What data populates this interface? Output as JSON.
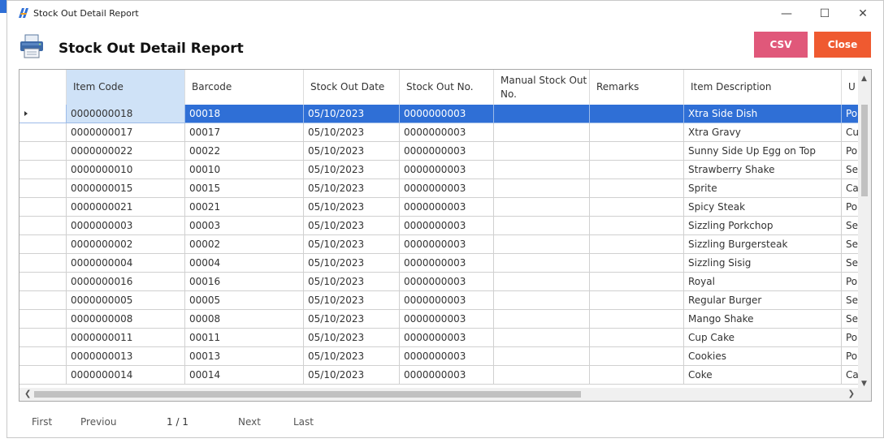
{
  "window": {
    "title": "Stock Out Detail Report",
    "min_glyph": "—",
    "max_glyph": "☐",
    "close_glyph": "✕"
  },
  "header": {
    "title": "Stock Out Detail Report",
    "csv_label": "CSV",
    "close_label": "Close"
  },
  "colors": {
    "accent": "#2f6fd6",
    "csv": "#e0587a",
    "close": "#ef5a30",
    "selected_header": "#cfe2f7"
  },
  "table": {
    "columns": [
      "Item Code",
      "Barcode",
      "Stock Out Date",
      "Stock Out No.",
      "Manual Stock Out No.",
      "Remarks",
      "Item Description",
      "U"
    ],
    "selected_row": 0,
    "rows": [
      [
        "0000000018",
        "00018",
        "05/10/2023",
        "0000000003",
        "",
        "",
        "Xtra Side Dish",
        "Po"
      ],
      [
        "0000000017",
        "00017",
        "05/10/2023",
        "0000000003",
        "",
        "",
        "Xtra Gravy",
        "Cu"
      ],
      [
        "0000000022",
        "00022",
        "05/10/2023",
        "0000000003",
        "",
        "",
        "Sunny Side Up Egg on Top",
        "Po"
      ],
      [
        "0000000010",
        "00010",
        "05/10/2023",
        "0000000003",
        "",
        "",
        "Strawberry Shake",
        "Se"
      ],
      [
        "0000000015",
        "00015",
        "05/10/2023",
        "0000000003",
        "",
        "",
        "Sprite",
        "Ca"
      ],
      [
        "0000000021",
        "00021",
        "05/10/2023",
        "0000000003",
        "",
        "",
        "Spicy Steak",
        "Po"
      ],
      [
        "0000000003",
        "00003",
        "05/10/2023",
        "0000000003",
        "",
        "",
        "Sizzling Porkchop",
        "Se"
      ],
      [
        "0000000002",
        "00002",
        "05/10/2023",
        "0000000003",
        "",
        "",
        "Sizzling Burgersteak",
        "Se"
      ],
      [
        "0000000004",
        "00004",
        "05/10/2023",
        "0000000003",
        "",
        "",
        "Sizzling  Sisig",
        "Se"
      ],
      [
        "0000000016",
        "00016",
        "05/10/2023",
        "0000000003",
        "",
        "",
        "Royal",
        "Po"
      ],
      [
        "0000000005",
        "00005",
        "05/10/2023",
        "0000000003",
        "",
        "",
        "Regular Burger",
        "Se"
      ],
      [
        "0000000008",
        "00008",
        "05/10/2023",
        "0000000003",
        "",
        "",
        "Mango Shake",
        "Se"
      ],
      [
        "0000000011",
        "00011",
        "05/10/2023",
        "0000000003",
        "",
        "",
        "Cup Cake",
        "Po"
      ],
      [
        "0000000013",
        "00013",
        "05/10/2023",
        "0000000003",
        "",
        "",
        "Cookies",
        "Po"
      ],
      [
        "0000000014",
        "00014",
        "05/10/2023",
        "0000000003",
        "",
        "",
        "Coke",
        "Ca"
      ]
    ]
  },
  "pager": {
    "first": "First",
    "previous": "Previou",
    "page": "1 / 1",
    "next": "Next",
    "last": "Last"
  }
}
